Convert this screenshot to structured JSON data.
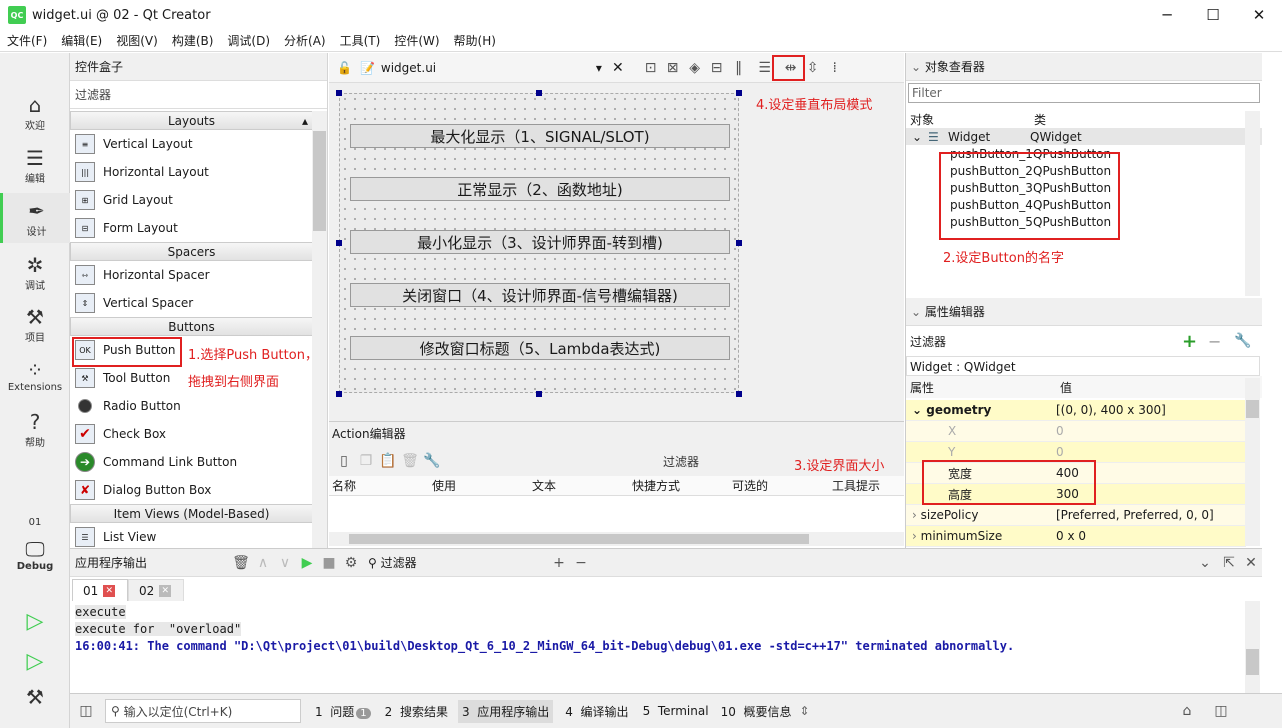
{
  "window": {
    "title": "widget.ui @ 02 - Qt Creator",
    "app_icon": "QC"
  },
  "menu": [
    "文件(F)",
    "编辑(E)",
    "视图(V)",
    "构建(B)",
    "调试(D)",
    "分析(A)",
    "工具(T)",
    "控件(W)",
    "帮助(H)"
  ],
  "modes": [
    {
      "label": "欢迎",
      "icon": "home-icon"
    },
    {
      "label": "编辑",
      "icon": "edit-icon"
    },
    {
      "label": "设计",
      "icon": "design-icon"
    },
    {
      "label": "调试",
      "icon": "debug-icon"
    },
    {
      "label": "项目",
      "icon": "wrench-icon"
    },
    {
      "label": "Extensions",
      "icon": "extensions-icon"
    },
    {
      "label": "帮助",
      "icon": "help-icon"
    }
  ],
  "kit": {
    "project": "01",
    "label": "Debug"
  },
  "widgetbox": {
    "title": "控件盒子",
    "filter": "过滤器",
    "cats": [
      "Layouts",
      "Spacers",
      "Buttons",
      "Item Views (Model-Based)"
    ],
    "layouts": [
      "Vertical Layout",
      "Horizontal Layout",
      "Grid Layout",
      "Form Layout"
    ],
    "spacers": [
      "Horizontal Spacer",
      "Vertical Spacer"
    ],
    "buttons": [
      "Push Button",
      "Tool Button",
      "Radio Button",
      "Check Box",
      "Command Link Button",
      "Dialog Button Box"
    ],
    "itemviews": [
      "List View"
    ]
  },
  "annotations": {
    "a1_line1": "1.选择Push Button，",
    "a1_line2": "拖拽到右侧界面",
    "a2": "2.设定Button的名字",
    "a3": "3.设定界面大小",
    "a4": "4.设定垂直布局模式"
  },
  "editor": {
    "file": "widget.ui"
  },
  "form": {
    "buttons": [
      "最大化显示（1、SIGNAL/SLOT)",
      "正常显示（2、函数地址)",
      "最小化显示（3、设计师界面-转到槽)",
      "关闭窗口（4、设计师界面-信号槽编辑器)",
      "修改窗口标题（5、Lambda表达式)"
    ]
  },
  "action_editor": {
    "title": "Action编辑器",
    "filter": "过滤器",
    "cols": [
      "名称",
      "使用",
      "文本",
      "快捷方式",
      "可选的",
      "工具提示"
    ]
  },
  "object_inspector": {
    "title": "对象查看器",
    "filter_ph": "Filter",
    "col_obj": "对象",
    "col_cls": "类",
    "root": {
      "name": "Widget",
      "cls": "QWidget"
    },
    "children": [
      {
        "name": "pushButton_1",
        "cls": "QPushButton"
      },
      {
        "name": "pushButton_2",
        "cls": "QPushButton"
      },
      {
        "name": "pushButton_3",
        "cls": "QPushButton"
      },
      {
        "name": "pushButton_4",
        "cls": "QPushButton"
      },
      {
        "name": "pushButton_5",
        "cls": "QPushButton"
      }
    ]
  },
  "property_editor": {
    "title": "属性编辑器",
    "filter": "过滤器",
    "context": "Widget : QWidget",
    "col_prop": "属性",
    "col_val": "值",
    "rows": [
      {
        "name": "geometry",
        "value": "[(0, 0), 400 x 300]"
      },
      {
        "name": "X",
        "value": "0"
      },
      {
        "name": "Y",
        "value": "0"
      },
      {
        "name": "宽度",
        "value": "400"
      },
      {
        "name": "高度",
        "value": "300"
      },
      {
        "name": "sizePolicy",
        "value": "[Preferred, Preferred, 0, 0]"
      },
      {
        "name": "minimumSize",
        "value": "0 x 0"
      }
    ]
  },
  "output": {
    "title": "应用程序输出",
    "filter": "过滤器",
    "tabs": [
      "01",
      "02"
    ],
    "lines": [
      "execute",
      "execute for  \"overload\"",
      "16:00:41: The command \"D:\\Qt\\project\\01\\build\\Desktop_Qt_6_10_2_MinGW_64_bit-Debug\\debug\\01.exe -std=c++17\" terminated abnormally."
    ]
  },
  "statusbar": {
    "locate_ph": "输入以定位(Ctrl+K)",
    "items": [
      {
        "n": "1",
        "t": "问题",
        "badge": "1"
      },
      {
        "n": "2",
        "t": "搜索结果"
      },
      {
        "n": "3",
        "t": "应用程序输出"
      },
      {
        "n": "4",
        "t": "编译输出"
      },
      {
        "n": "5",
        "t": "Terminal"
      },
      {
        "n": "10",
        "t": "概要信息"
      }
    ]
  },
  "colors": {
    "accent": "#41cd52",
    "annotation": "#e02020",
    "output_blue": "#1a1aa6"
  }
}
